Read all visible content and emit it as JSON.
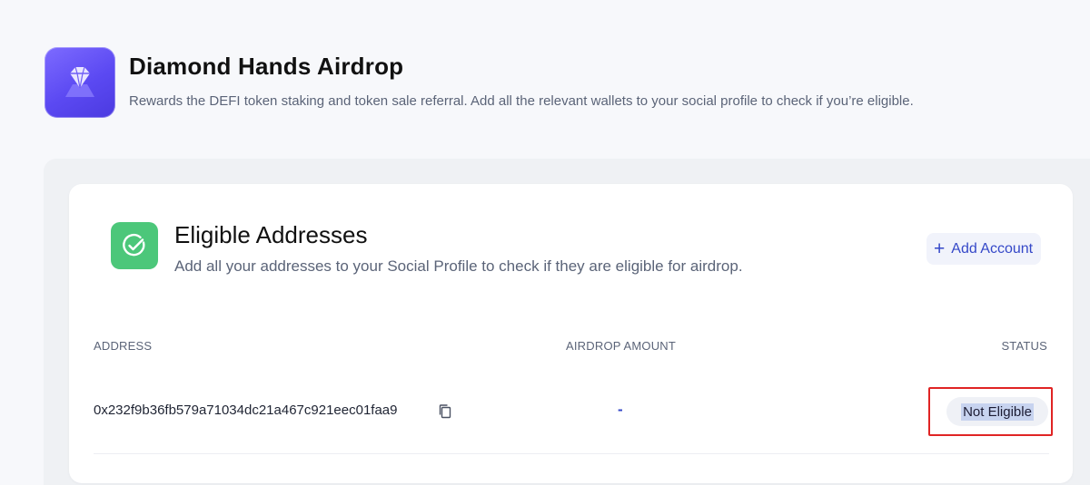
{
  "airdrop": {
    "title": "Diamond Hands Airdrop",
    "description": "Rewards the DEFI token staking and token sale referral. Add all the relevant wallets to your social profile to check if you’re eligible."
  },
  "eligible": {
    "title": "Eligible Addresses",
    "description": "Add all your addresses to your Social Profile to check if they are eligible for airdrop.",
    "add_account_label": "Add Account",
    "add_account_icon": "+"
  },
  "table": {
    "columns": [
      "ADDRESS",
      "AIRDROP AMOUNT",
      "STATUS"
    ],
    "rows": [
      {
        "address": "0x232f9b36fb579a71034dc21a467c921eec01faa9",
        "amount": "-",
        "status": "Not Eligible"
      }
    ]
  },
  "colors": {
    "accent": "#3548c8",
    "app_icon": "#5b49f2",
    "check_icon_bg": "#4cc77a",
    "highlight_border": "#e02424"
  },
  "icons": {
    "app": "diamond-icon",
    "section": "check-circle-icon",
    "copy": "copy-icon",
    "add": "plus-icon"
  }
}
